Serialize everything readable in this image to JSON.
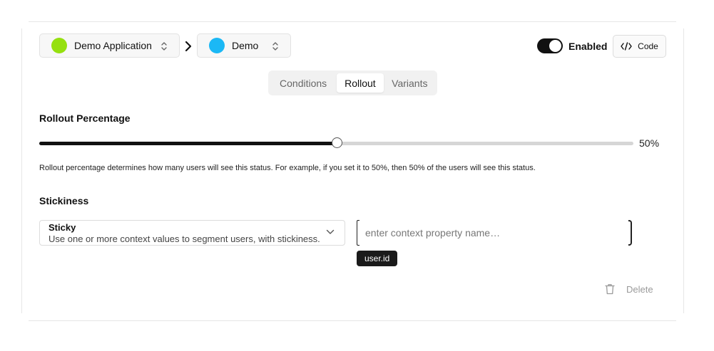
{
  "header": {
    "app_selector": {
      "label": "Demo Application",
      "color": "#95e00f"
    },
    "env_selector": {
      "label": "Demo",
      "color": "#1bb8f5"
    },
    "toggle": {
      "label": "Enabled",
      "on": true
    },
    "code_button": {
      "label": "Code"
    }
  },
  "tabs": [
    {
      "label": "Conditions",
      "active": false
    },
    {
      "label": "Rollout",
      "active": true
    },
    {
      "label": "Variants",
      "active": false
    }
  ],
  "rollout": {
    "title": "Rollout Percentage",
    "value": 50,
    "value_label": "50%",
    "help": "Rollout percentage determines how many users will see this status. For example, if you set it to 50%, then 50% of the users will see this status."
  },
  "stickiness": {
    "title": "Stickiness",
    "select": {
      "title": "Sticky",
      "description": "Use one or more context values to segment users, with stickiness."
    },
    "property_input": {
      "placeholder": "enter context property name…",
      "value": ""
    },
    "tags": [
      "user.id"
    ]
  },
  "delete_button": {
    "label": "Delete"
  }
}
